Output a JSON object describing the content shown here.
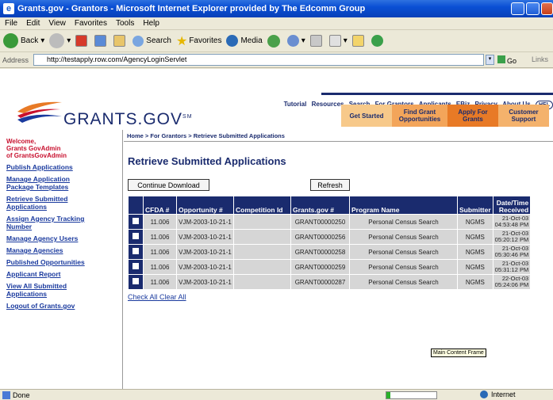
{
  "window": {
    "title": "Grants.gov - Grantors - Microsoft Internet Explorer provided by The Edcomm Group"
  },
  "menu": [
    "File",
    "Edit",
    "View",
    "Favorites",
    "Tools",
    "Help"
  ],
  "toolbar": {
    "back": "Back",
    "search": "Search",
    "favorites": "Favorites",
    "media": "Media"
  },
  "address": {
    "label": "Address",
    "url": "http://testapply.row.com/AgencyLoginServlet",
    "go": "Go",
    "links": "Links"
  },
  "site": {
    "logo": "GRANTS.GOV",
    "logo_mark": "SM",
    "topnav": [
      "Tutorial",
      "Resources",
      "Search",
      "For Grantors",
      "Applicants",
      "EBiz",
      "Privacy",
      "About Us"
    ],
    "help": "HEL",
    "tabs": [
      {
        "label": "Get Started",
        "color": "#f7c98a"
      },
      {
        "label": "Find Grant Opportunities",
        "color": "#f3a55a"
      },
      {
        "label": "Apply For Grants",
        "color": "#e87a26"
      },
      {
        "label": "Customer Support",
        "color": "#f4b26c"
      }
    ]
  },
  "sidebar": {
    "welcome": [
      "Welcome,",
      "Grants GovAdmin",
      "of GrantsGovAdmin"
    ],
    "links": [
      "Publish Applications",
      "Manage Application Package Templates",
      "Retrieve Submitted Applications",
      "Assign Agency Tracking Number",
      "Manage Agency Users",
      "Manage Agencies",
      "Published Opportunities",
      "Applicant Report",
      "View All Submitted Applications",
      "Logout of Grants.gov"
    ]
  },
  "main": {
    "breadcrumb": "Home > For Grantors > Retrieve Submitted Applications",
    "title": "Retrieve Submitted Applications",
    "continue_button": "Continue Download",
    "refresh_button": "Refresh",
    "columns": [
      "CFDA #",
      "Opportunity #",
      "Competition Id",
      "Grants.gov #",
      "Program Name",
      "Submitter",
      "Date/Time Received"
    ],
    "rows": [
      {
        "cfda": "11.006",
        "opp": "VJM-2003-10-21-1",
        "comp": "",
        "gg": "GRANT00000250",
        "prog": "Personal Census Search",
        "sub": "NGMS",
        "date": "21-Oct-03",
        "time": "04:53:48 PM"
      },
      {
        "cfda": "11.006",
        "opp": "VJM-2003-10-21-1",
        "comp": "",
        "gg": "GRANT00000256",
        "prog": "Personal Census Search",
        "sub": "NGMS",
        "date": "21-Oct-03",
        "time": "05:20:12 PM"
      },
      {
        "cfda": "11.006",
        "opp": "VJM-2003-10-21-1",
        "comp": "",
        "gg": "GRANT00000258",
        "prog": "Personal Census Search",
        "sub": "NGMS",
        "date": "21-Oct-03",
        "time": "05:30:46 PM"
      },
      {
        "cfda": "11.006",
        "opp": "VJM-2003-10-21-1",
        "comp": "",
        "gg": "GRANT00000259",
        "prog": "Personal Census Search",
        "sub": "NGMS",
        "date": "21-Oct-03",
        "time": "05:31:12 PM"
      },
      {
        "cfda": "11.006",
        "opp": "VJM-2003-10-21-1",
        "comp": "",
        "gg": "GRANT00000287",
        "prog": "Personal Census Search",
        "sub": "NGMS",
        "date": "22-Oct-03",
        "time": "05:24:06 PM"
      }
    ],
    "check_all": "Check All",
    "clear_all": "Clear All",
    "frame_tooltip": "Main Content Frame"
  },
  "status": {
    "text": "Done",
    "zone": "Internet"
  }
}
